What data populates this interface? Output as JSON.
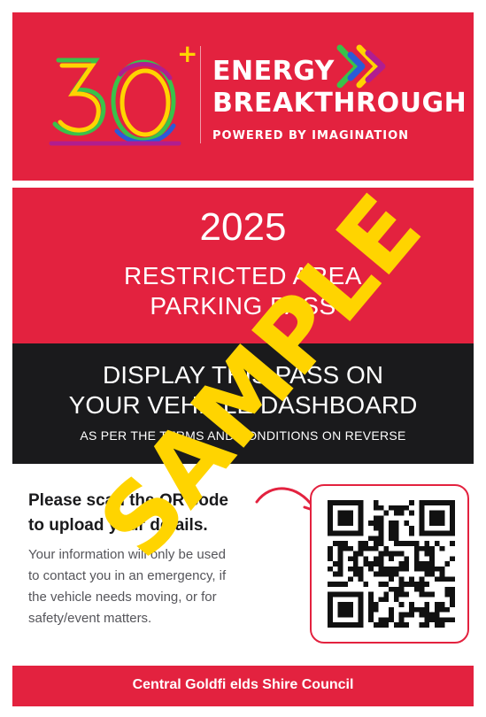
{
  "header": {
    "logo_number": "30",
    "logo_plus": "+",
    "brand_line1": "ENERGY",
    "brand_line2": "BREAKTHROUGH",
    "tagline": "POWERED BY IMAGINATION"
  },
  "pass": {
    "year": "2025",
    "title_line1": "RESTRICTED AREA",
    "title_line2": "PARKING PASS",
    "display_line1": "DISPLAY THIS PASS ON",
    "display_line2": "YOUR VEHICLE DASHBOARD",
    "terms": "AS PER THE TERMS AND CONDITIONS ON REVERSE"
  },
  "info": {
    "heading_line1": "Please scan the QR code",
    "heading_line2": "to upload your details.",
    "body_lines": [
      "Your information will only be used",
      "to contact you in an emergency, if",
      "the vehicle needs moving, or for",
      "safety/event matters."
    ]
  },
  "footer": {
    "text": "Central Goldfi elds Shire Council"
  },
  "watermark": {
    "text": "SAMPLE"
  },
  "colors": {
    "brand_red": "#e3223f",
    "band_black": "#1a1a1c",
    "watermark_yellow": "#ffd400"
  }
}
